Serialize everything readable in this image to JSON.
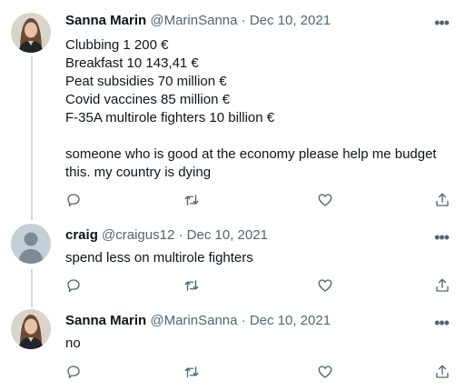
{
  "tweets": [
    {
      "author": "Sanna Marin",
      "handle": "@MarinSanna",
      "separator": "·",
      "date": "Dec 10, 2021",
      "lines": [
        "Clubbing 1 200 €",
        "Breakfast 10 143,41 €",
        "Peat subsidies 70 million €",
        "Covid vaccines 85 million €",
        "F-35A multirole fighters 10 billion €",
        "",
        "someone who is good at the economy please help me budget",
        "this. my country is dying"
      ],
      "avatar": "photo-avatar"
    },
    {
      "author": "craig",
      "handle": "@craigus12",
      "separator": "·",
      "date": "Dec 10, 2021",
      "lines": [
        "spend less on multirole fighters"
      ],
      "avatar": "default-avatar"
    },
    {
      "author": "Sanna Marin",
      "handle": "@MarinSanna",
      "separator": "·",
      "date": "Dec 10, 2021",
      "lines": [
        "no"
      ],
      "avatar": "photo-avatar"
    }
  ],
  "more_glyph": "•••",
  "icons": [
    "reply-icon",
    "retweet-icon",
    "like-icon",
    "share-icon"
  ],
  "colors": {
    "text": "#0f1419",
    "muted": "#536471",
    "thread_line": "#cfd9de",
    "background": "#ffffff"
  }
}
